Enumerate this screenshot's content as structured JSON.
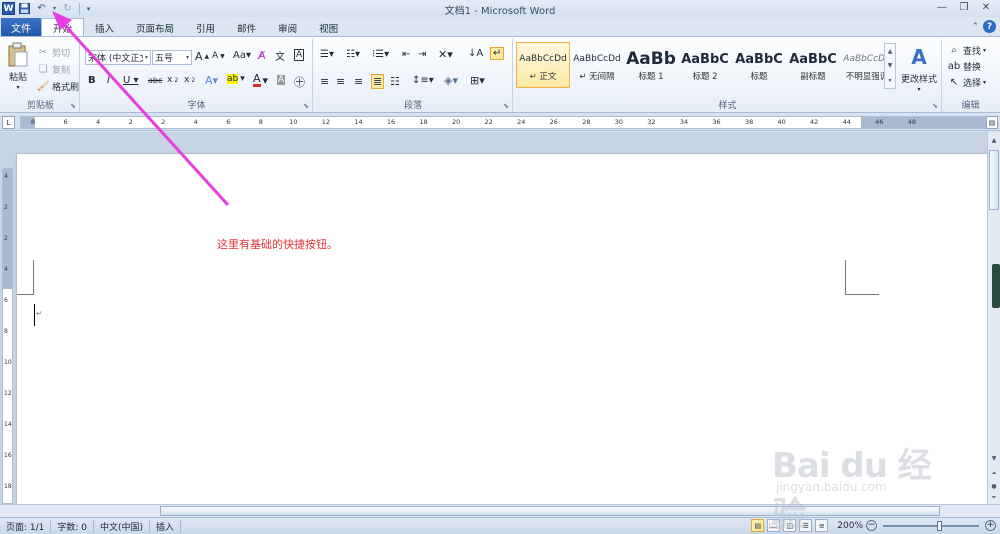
{
  "window": {
    "title": "文档1 - Microsoft Word",
    "app_icon": "W"
  },
  "tabs": {
    "file": "文件",
    "items": [
      "开始",
      "插入",
      "页面布局",
      "引用",
      "邮件",
      "审阅",
      "视图"
    ]
  },
  "clipboard": {
    "paste": "粘贴",
    "cut": "剪切",
    "copy": "复制",
    "format_painter": "格式刷",
    "label": "剪贴板"
  },
  "font": {
    "family": "宋体 (中文正文)",
    "size": "五号",
    "label": "字体"
  },
  "paragraph": {
    "label": "段落"
  },
  "styles": {
    "items": [
      {
        "sample": "AaBbCcDd",
        "name": "↵ 正文"
      },
      {
        "sample": "AaBbCcDd",
        "name": "↵ 无间隔"
      },
      {
        "sample": "AaBb",
        "name": "标题 1"
      },
      {
        "sample": "AaBbC",
        "name": "标题 2"
      },
      {
        "sample": "AaBbC",
        "name": "标题"
      },
      {
        "sample": "AaBbC",
        "name": "副标题"
      },
      {
        "sample": "AaBbCcDd",
        "name": "不明显强调"
      }
    ],
    "change_styles": "更改样式",
    "label": "样式"
  },
  "editing": {
    "find": "查找",
    "replace": "替换",
    "select": "选择",
    "label": "编辑"
  },
  "ruler": {
    "numbers": [
      "8",
      "6",
      "4",
      "2",
      "2",
      "4",
      "6",
      "8",
      "10",
      "12",
      "14",
      "16",
      "18",
      "20",
      "22",
      "24",
      "26",
      "28",
      "30",
      "32",
      "34",
      "36",
      "38",
      "40",
      "42",
      "44",
      "46",
      "48"
    ]
  },
  "vruler": {
    "numbers": [
      "4",
      "2",
      "2",
      "4",
      "6",
      "8",
      "10",
      "12",
      "14",
      "16",
      "18"
    ]
  },
  "document": {
    "annotation": "这里有基础的快捷按钮。",
    "annotation_color": "#e8343a",
    "paragraph_mark": "↵"
  },
  "status": {
    "page": "页面: 1/1",
    "words": "字数: 0",
    "language": "中文(中国)",
    "mode": "插入",
    "zoom": "200%"
  },
  "watermark": {
    "text": "Bai du 经验",
    "url": "jingyan.baidu.com"
  },
  "colors": {
    "accent": "#2a5caa",
    "arrow": "#e83de0"
  }
}
